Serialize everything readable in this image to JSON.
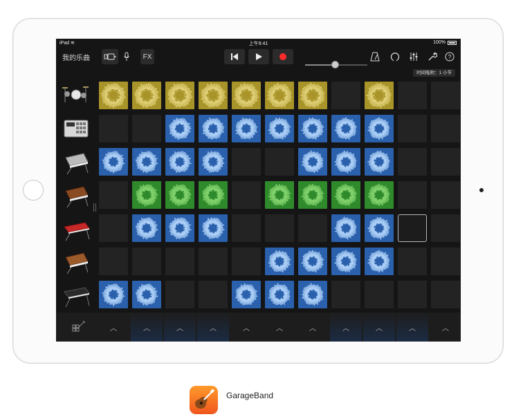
{
  "status_bar": {
    "device": "iPad",
    "time": "上午9:41",
    "battery": "100%"
  },
  "toolbar": {
    "my_songs": "我的乐曲",
    "fx": "FX",
    "icons": [
      "loop-browser-icon",
      "mic-icon",
      "rewind-icon",
      "play-icon",
      "record-icon",
      "metronome-icon",
      "loops-icon",
      "mixer-icon",
      "settings-wrench-icon",
      "help-icon"
    ],
    "volume_level": 0.48,
    "record_color": "#ff2a2a"
  },
  "quantize": {
    "label": "时间吸附：1 小节"
  },
  "colors": {
    "yellow": "#a89428",
    "blue": "#2a60ac",
    "green": "#2f8a2b",
    "empty": "#232323"
  },
  "tracks": [
    {
      "instrument": "drum-kit",
      "cells": [
        "yellow",
        "yellow",
        "yellow",
        "yellow",
        "yellow",
        "yellow",
        "yellow",
        "empty",
        "yellow",
        "empty",
        "empty"
      ]
    },
    {
      "instrument": "beat-sequencer",
      "cells": [
        "empty",
        "empty",
        "blue",
        "blue",
        "blue",
        "blue",
        "blue",
        "blue",
        "blue",
        "empty",
        "empty"
      ]
    },
    {
      "instrument": "keyboard-synth",
      "cells": [
        "blue",
        "blue",
        "blue",
        "blue",
        "empty",
        "empty",
        "blue",
        "blue",
        "blue",
        "empty",
        "empty"
      ]
    },
    {
      "instrument": "analog-synth",
      "cells": [
        "empty",
        "green",
        "green",
        "green",
        "empty",
        "green",
        "green",
        "green",
        "green",
        "empty",
        "empty"
      ]
    },
    {
      "instrument": "red-keyboard",
      "cells": [
        "empty",
        "blue",
        "blue",
        "blue",
        "empty",
        "empty",
        "empty",
        "blue",
        "blue",
        "selected",
        "empty"
      ]
    },
    {
      "instrument": "analog-synth-2",
      "cells": [
        "empty",
        "empty",
        "empty",
        "empty",
        "empty",
        "blue",
        "blue",
        "blue",
        "blue",
        "empty",
        "empty"
      ]
    },
    {
      "instrument": "digital-piano",
      "cells": [
        "blue",
        "blue",
        "empty",
        "empty",
        "blue",
        "blue",
        "blue",
        "empty",
        "empty",
        "empty",
        "empty"
      ]
    }
  ],
  "bottom_bar": {
    "trigger_glyph": "︿",
    "columns": 11,
    "glow_columns": [
      1,
      2,
      3,
      7,
      8,
      9
    ]
  },
  "app": {
    "name": "GarageBand"
  }
}
